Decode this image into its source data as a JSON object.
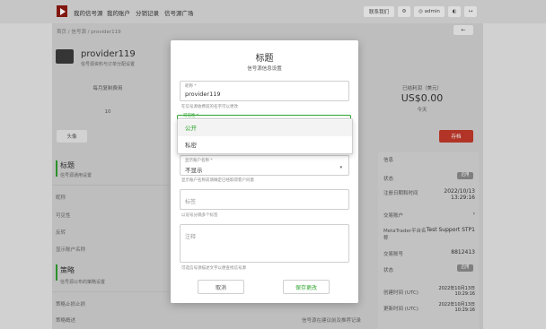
{
  "nav": {
    "items": [
      "我的信号源",
      "我的账户",
      "分销记录",
      "信号源广场"
    ],
    "right_buttons": [
      "联系我们",
      "⚙",
      "◎ admin",
      "◐",
      "↦"
    ]
  },
  "breadcrumb": "首页 / 信号源 / provider119",
  "back_label": "←",
  "provider": {
    "name": "provider119",
    "subtitle": "信号源资料与订单分配设置"
  },
  "stats": {
    "left_label": "每月复制费用",
    "left_value": "10",
    "right_label": "已结利润（美元）",
    "right_value": "US$0.00",
    "right_sub": "今天"
  },
  "buttons": {
    "left_action": "头像",
    "right_action": "存档"
  },
  "section1": {
    "title": "标题",
    "subtitle": "信号源通用设置",
    "rows": [
      "昵称",
      "可见性",
      "反转",
      "显示账户名称"
    ]
  },
  "section2": {
    "title": "策略",
    "subtitle": "信号源公布的策略设置",
    "rows": [
      "策略止损止损",
      "策略概述"
    ]
  },
  "bottom_note": "信号源在建议前及推荐记录",
  "right_panel": {
    "header": "信息",
    "rows": [
      {
        "label": "状态",
        "value": "启用",
        "pill": true
      },
      {
        "label": "注册日期和时间",
        "value": "2022/10/13 13:29:16",
        "pill": false
      },
      {
        "label": "交易账户",
        "value": "›",
        "pill": false
      },
      {
        "label": "MetaTrader平台名称",
        "value": "Test Support STP1",
        "pill": false
      },
      {
        "label": "交易账号",
        "value": "8812413",
        "pill": false
      },
      {
        "label": "状态",
        "value": "启用",
        "pill": true
      },
      {
        "label": "创建时间 (UTC)",
        "value": "2022年10月13日 10:29:16",
        "pill": false
      },
      {
        "label": "更新时间 (UTC)",
        "value": "2022年10月13日 10:29:16",
        "pill": false
      }
    ]
  },
  "modal": {
    "title": "标题",
    "subtitle": "信号源信息设置",
    "name_label": "昵称 *",
    "name_value": "provider119",
    "name_hint": "在信号源收费前的名字可以更改",
    "visibility_label": "可见性 *",
    "dropdown_options": [
      "公开",
      "私密"
    ],
    "field3_label": "显示账户名称 *",
    "field3_value": "不显示",
    "field3_hint": "显示账户名称前请确定已经取得客户同意",
    "field4_placeholder": "标签",
    "field4_hint": "以逗号分隔多个标签",
    "field5_placeholder": "注释",
    "field5_hint": "可选信号源描述文字以便查找信号源",
    "cancel": "取消",
    "save": "保存更改"
  },
  "colors": {
    "accent_green": "#2fa52f",
    "danger": "#c0392b",
    "brand": "#8e1a12"
  }
}
